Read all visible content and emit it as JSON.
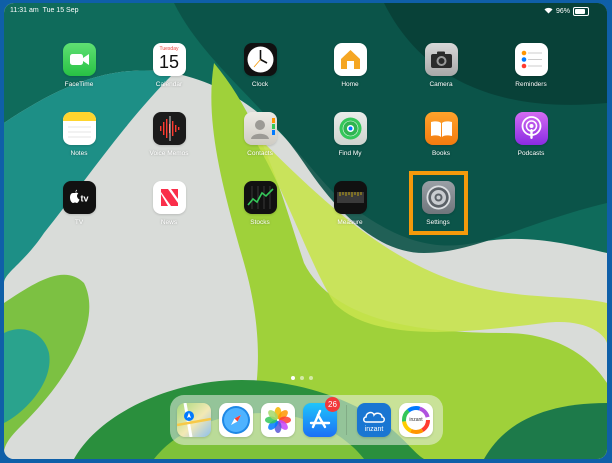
{
  "status_bar": {
    "time": "11:31 am",
    "date": "Tue 15 Sep",
    "battery": "96%"
  },
  "apps": {
    "facetime": "FaceTime",
    "calendar": "Calendar",
    "calendar_day": "Tuesday",
    "calendar_date": "15",
    "clock": "Clock",
    "home": "Home",
    "camera": "Camera",
    "reminders": "Reminders",
    "notes": "Notes",
    "voice_memos": "Voice Memos",
    "contacts": "Contacts",
    "find_my": "Find My",
    "books": "Books",
    "podcasts": "Podcasts",
    "tv": "TV",
    "news": "News",
    "stocks": "Stocks",
    "measure": "Measure",
    "settings": "Settings"
  },
  "dock": {
    "app_store_badge": "26",
    "inzant_label": "inzant",
    "app_icons": [
      "maps-icon",
      "safari-icon",
      "photos-icon",
      "app-store-icon",
      "inzant-icon",
      "inzant-colorful-icon"
    ]
  },
  "page_dots": {
    "count": 3,
    "active": 1
  },
  "highlight_color": "#f59a0b"
}
